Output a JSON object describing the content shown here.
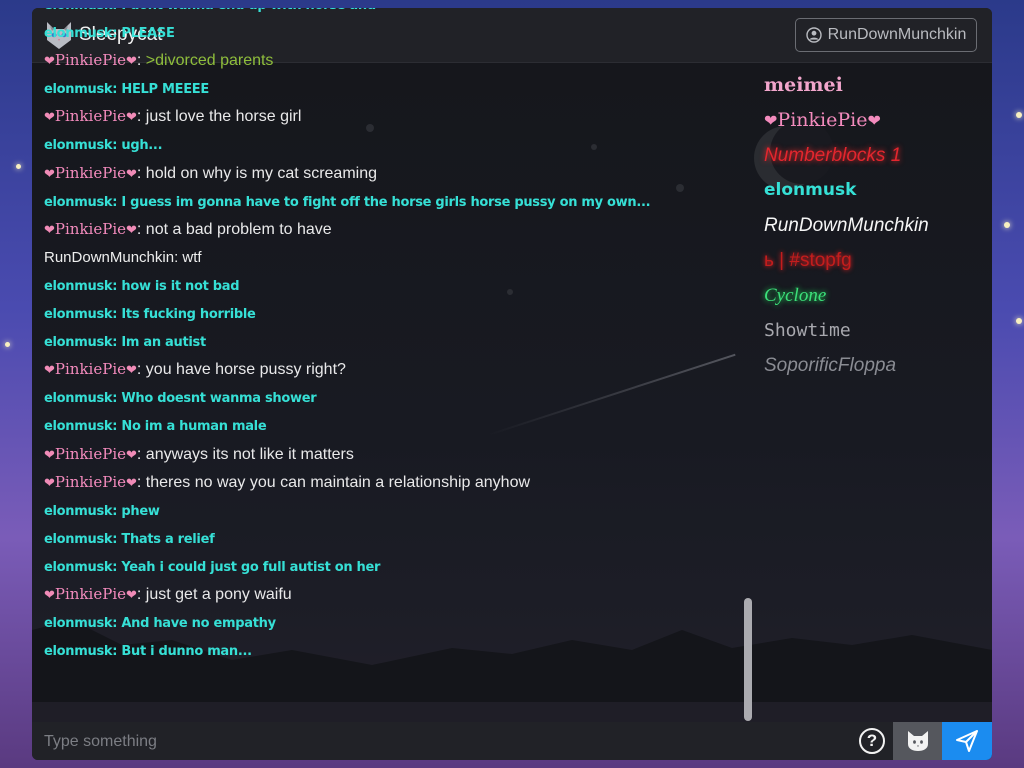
{
  "header": {
    "brand": "Sleepycat",
    "user_button": "RunDownMunchkin"
  },
  "messages": [
    {
      "user": "elonmusk",
      "style": "elon",
      "text": "I dont wanna end up with horse and"
    },
    {
      "user": "elonmusk",
      "style": "elon",
      "text": "PLEASE"
    },
    {
      "user": "PinkiePie",
      "style": "pinkie",
      "text": ">divorced parents",
      "greentext": true
    },
    {
      "user": "elonmusk",
      "style": "elon",
      "text": "HELP MEEEE"
    },
    {
      "user": "PinkiePie",
      "style": "pinkie",
      "text": "just love the horse girl"
    },
    {
      "user": "elonmusk",
      "style": "elon",
      "text": "ugh..."
    },
    {
      "user": "PinkiePie",
      "style": "pinkie",
      "text": "hold on why is my cat screaming"
    },
    {
      "user": "elonmusk",
      "style": "elon",
      "text": "I guess im gonna have to fight off the horse girls horse pussy on my own..."
    },
    {
      "user": "PinkiePie",
      "style": "pinkie",
      "text": "not a bad problem to have"
    },
    {
      "user": "RunDownMunchkin",
      "style": "run",
      "text": "wtf"
    },
    {
      "user": "elonmusk",
      "style": "elon",
      "text": "how is it not bad"
    },
    {
      "user": "elonmusk",
      "style": "elon",
      "text": "Its fucking horrible"
    },
    {
      "user": "elonmusk",
      "style": "elon",
      "text": "Im an autist"
    },
    {
      "user": "PinkiePie",
      "style": "pinkie",
      "text": "you have horse pussy right?"
    },
    {
      "user": "elonmusk",
      "style": "elon",
      "text": "Who doesnt wanma shower"
    },
    {
      "user": "elonmusk",
      "style": "elon",
      "text": "No im a human male"
    },
    {
      "user": "PinkiePie",
      "style": "pinkie",
      "text": "anyways its not like it matters"
    },
    {
      "user": "PinkiePie",
      "style": "pinkie",
      "text": "theres no way you can maintain a relationship anyhow"
    },
    {
      "user": "elonmusk",
      "style": "elon",
      "text": "phew"
    },
    {
      "user": "elonmusk",
      "style": "elon",
      "text": "Thats a relief"
    },
    {
      "user": "elonmusk",
      "style": "elon",
      "text": "Yeah i could just go full autist on her"
    },
    {
      "user": "PinkiePie",
      "style": "pinkie",
      "text": "just get a pony waifu"
    },
    {
      "user": "elonmusk",
      "style": "elon",
      "text": "And have no empathy"
    },
    {
      "user": "elonmusk",
      "style": "elon",
      "text": "But i dunno man..."
    }
  ],
  "users": [
    {
      "name": "meimei",
      "style": "meimei"
    },
    {
      "name": "PinkiePie",
      "style": "pinkie"
    },
    {
      "name": "Numberblocks 1",
      "style": "number"
    },
    {
      "name": "elonmusk",
      "style": "elon"
    },
    {
      "name": "RunDownMunchkin",
      "style": "run"
    },
    {
      "name": "ь | #stopfg",
      "style": "stop"
    },
    {
      "name": "Cyclone",
      "style": "cyc"
    },
    {
      "name": "Showtime",
      "style": "show"
    },
    {
      "name": "SoporificFloppa",
      "style": "sopo"
    }
  ],
  "input": {
    "placeholder": "Type something",
    "help_label": "?"
  },
  "icons": {
    "logo": "cat-logo-icon",
    "user": "user-circle-icon",
    "cat": "cat-icon",
    "send": "send-icon"
  },
  "colors": {
    "elon": "#36e0d6",
    "pinkie": "#f38bbd",
    "send_button": "#1b8cf0",
    "window_bg": "#1e1f24"
  }
}
